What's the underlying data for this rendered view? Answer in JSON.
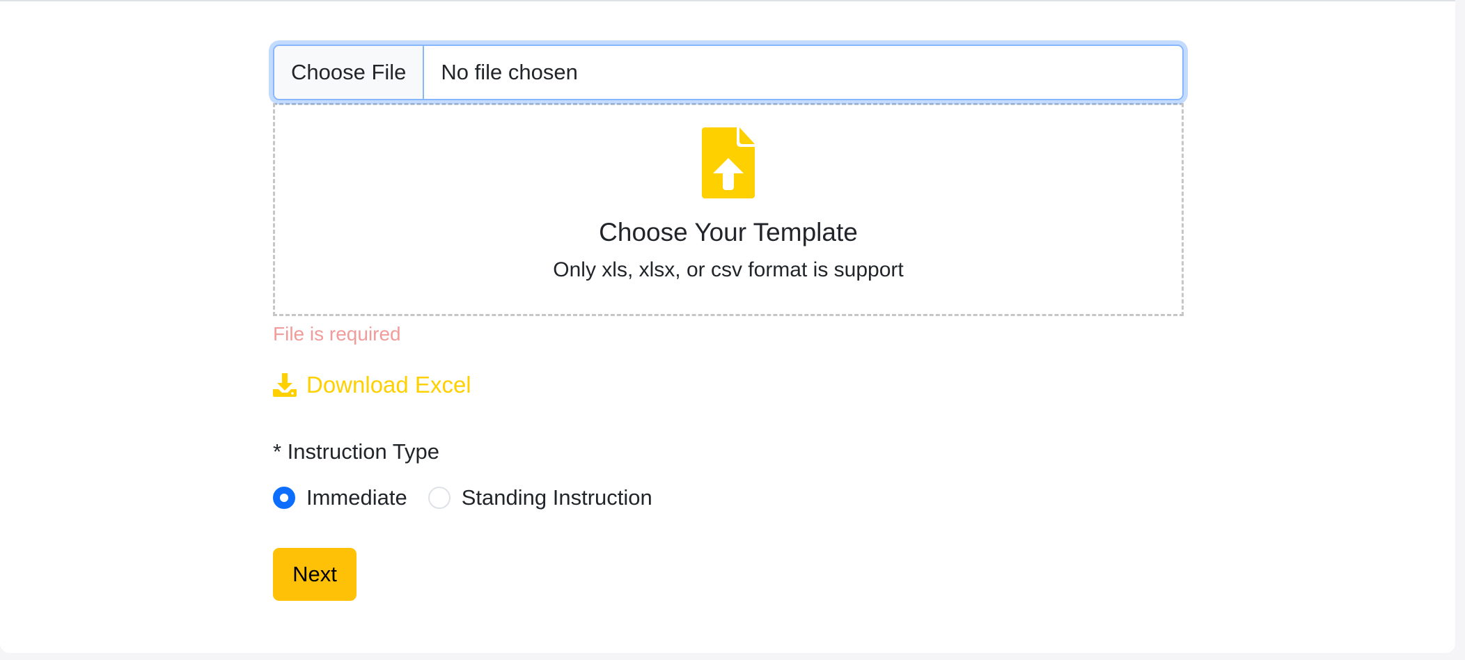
{
  "file_input": {
    "button_label": "Choose File",
    "status_text": "No file chosen"
  },
  "drop_zone": {
    "icon": "file-upload-icon",
    "title": "Choose Your Template",
    "subtitle": "Only xls, xlsx, or csv format is support"
  },
  "error": {
    "message": "File is required"
  },
  "download": {
    "icon": "download-icon",
    "label": "Download Excel"
  },
  "instruction_type": {
    "label": "* Instruction Type",
    "options": [
      {
        "label": "Immediate",
        "checked": true
      },
      {
        "label": "Standing Instruction",
        "checked": false
      }
    ]
  },
  "actions": {
    "next_label": "Next"
  },
  "colors": {
    "accent_yellow": "#ffd000",
    "button_yellow": "#ffc107",
    "radio_blue": "#0d6efd",
    "error_red": "#f29b9b",
    "focus_blue": "#86b7fe"
  }
}
